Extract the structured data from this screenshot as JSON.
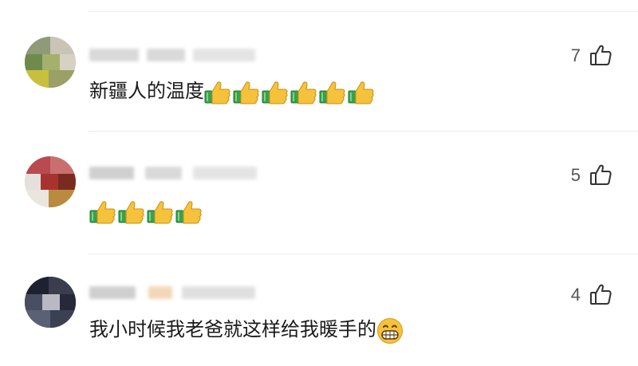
{
  "comments": [
    {
      "text": "新疆人的温度",
      "emoji": [
        "thumbs-up",
        "thumbs-up",
        "thumbs-up",
        "thumbs-up",
        "thumbs-up",
        "thumbs-up"
      ],
      "likes": "7"
    },
    {
      "text": "",
      "emoji": [
        "thumbs-up",
        "thumbs-up",
        "thumbs-up",
        "thumbs-up"
      ],
      "likes": "5"
    },
    {
      "text": "我小时候我老爸就这样给我暖手的",
      "emoji": [
        "grinning-face"
      ],
      "likes": "4"
    }
  ],
  "colors": {
    "divider": "#ececec",
    "text": "#1a1a1a",
    "like_count": "#555555",
    "thumb_yellow": "#f5c33b",
    "cuff_green": "#3aa14a"
  }
}
